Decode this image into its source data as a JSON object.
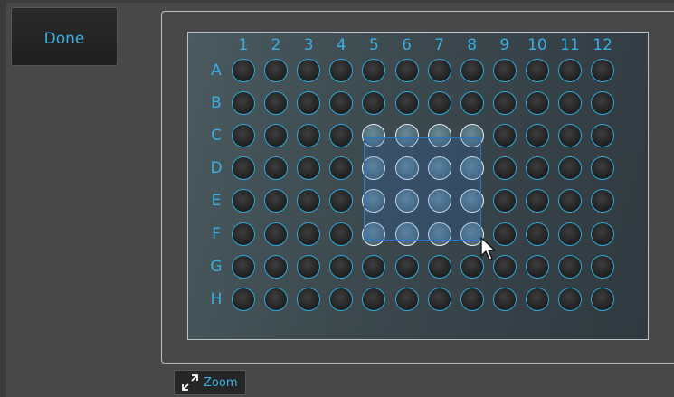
{
  "toolbar": {
    "done_label": "Done",
    "zoom_label": "Zoom"
  },
  "plate": {
    "columns": [
      "1",
      "2",
      "3",
      "4",
      "5",
      "6",
      "7",
      "8",
      "9",
      "10",
      "11",
      "12"
    ],
    "rows": [
      "A",
      "B",
      "C",
      "D",
      "E",
      "F",
      "G",
      "H"
    ],
    "selected_rows": [
      "C",
      "D",
      "E",
      "F"
    ],
    "selected_columns": [
      "5",
      "6",
      "7",
      "8"
    ]
  },
  "colors": {
    "accent": "#3aaee0",
    "well_fill": "#1c1c1c",
    "selected_well_fill": "#5a7a86",
    "selection_border": "#2a78c8"
  },
  "icons": {
    "zoom": "expand-arrows-icon",
    "pointer": "mouse-cursor-icon"
  }
}
